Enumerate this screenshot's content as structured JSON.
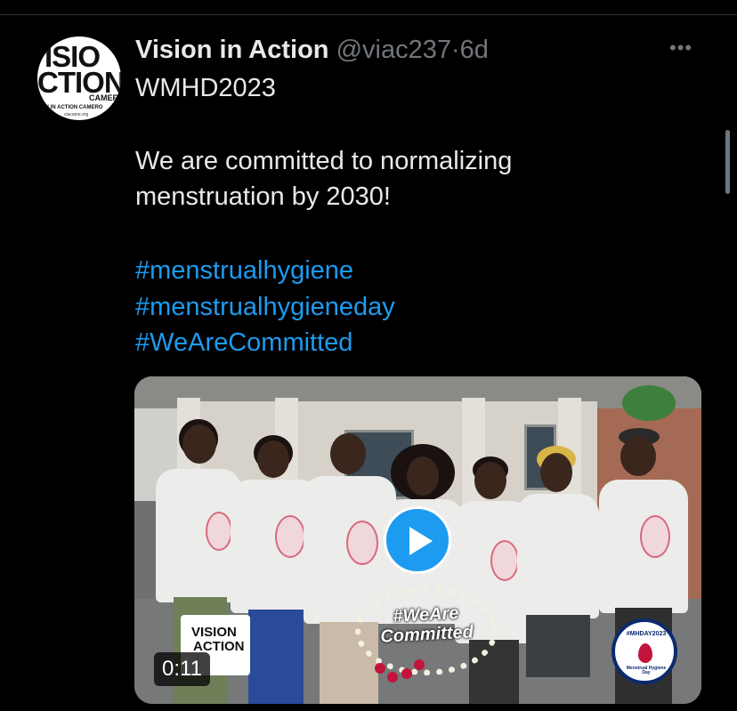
{
  "tweet": {
    "avatar_text": {
      "line1": "ISIO",
      "line2": "CTION",
      "line3": "CAMERO",
      "line4": "ON IN ACTION CAMERO",
      "line5": "viacame.org"
    },
    "display_name": "Vision in Action",
    "handle": "@viac237",
    "separator": "·",
    "time": "6d",
    "more_icon": "more-horizontal-icon",
    "text_lines": [
      "WMHD2023",
      "We are committed to normalizing",
      "menstruation by 2030!"
    ],
    "hashtags": [
      "#menstrualhygiene",
      "#menstrualhygieneday",
      "#WeAreCommitted"
    ],
    "link_color": "#1d9bf0"
  },
  "media": {
    "video_duration": "0:11",
    "play_icon": "play-icon",
    "overlay_text": "#WeAre Committed",
    "logo_text": [
      "VISION",
      "ACTION"
    ],
    "badge_top": "#MHDAY2023",
    "badge_bottom": "Menstrual Hygiene Day"
  }
}
